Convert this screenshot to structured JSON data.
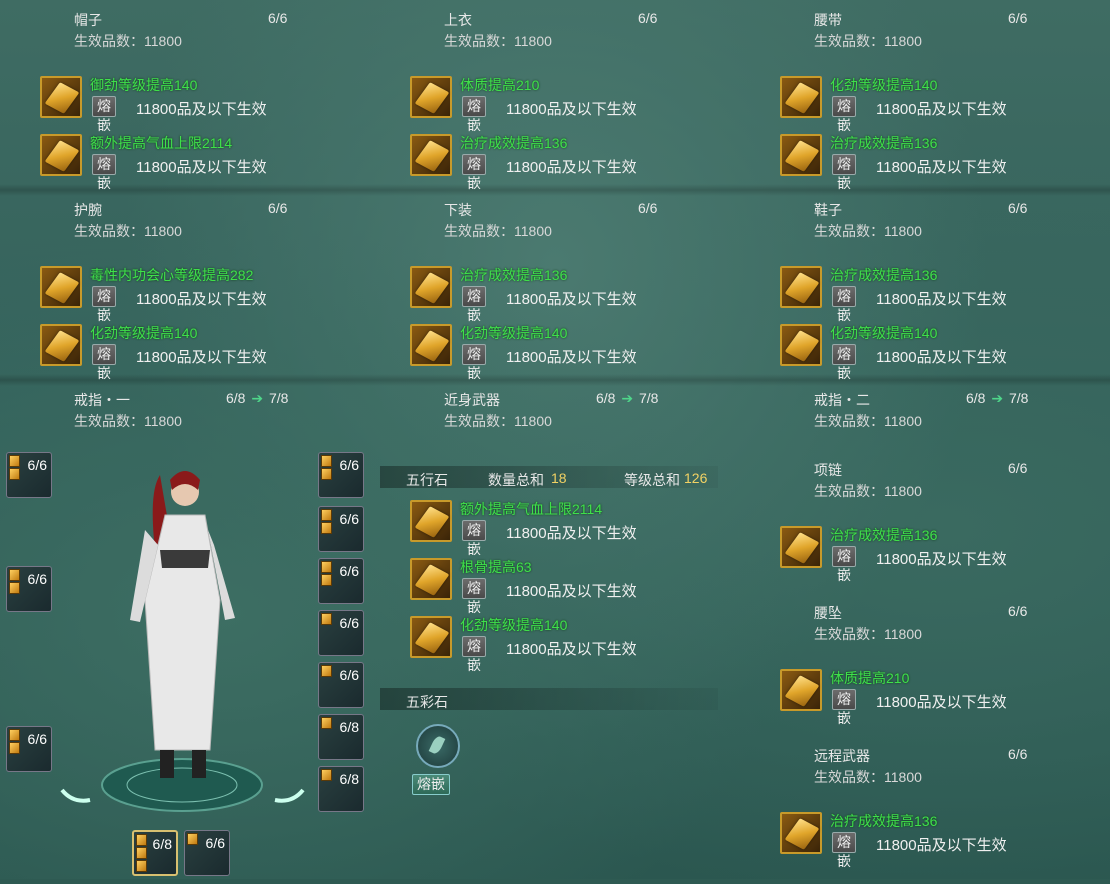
{
  "fuse_label": "熔嵌",
  "fuse_desc": "11800品及以下生效",
  "effect_label": "生效品数：11800",
  "equipment": [
    {
      "name": "帽子",
      "count": "6/6",
      "gems": [
        "御劲等级提高140",
        "额外提高气血上限2114"
      ]
    },
    {
      "name": "上衣",
      "count": "6/6",
      "gems": [
        "体质提高210",
        "治疗成效提高136"
      ]
    },
    {
      "name": "腰带",
      "count": "6/6",
      "gems": [
        "化劲等级提高140",
        "治疗成效提高136"
      ]
    },
    {
      "name": "护腕",
      "count": "6/6",
      "gems": [
        "毒性内功会心等级提高282",
        "化劲等级提高140"
      ]
    },
    {
      "name": "下装",
      "count": "6/6",
      "gems": [
        "治疗成效提高136",
        "化劲等级提高140"
      ]
    },
    {
      "name": "鞋子",
      "count": "6/6",
      "gems": [
        "治疗成效提高136",
        "化劲等级提高140"
      ]
    }
  ],
  "upgrades": [
    {
      "name": "戒指・一",
      "count": "6/8",
      "next": "7/8"
    },
    {
      "name": "近身武器",
      "count": "6/8",
      "next": "7/8"
    },
    {
      "name": "戒指・二",
      "count": "6/8",
      "next": "7/8"
    }
  ],
  "right_items": [
    {
      "name": "项链",
      "count": "6/6",
      "gem": "治疗成效提高136"
    },
    {
      "name": "腰坠",
      "count": "6/6",
      "gem": "体质提高210"
    },
    {
      "name": "远程武器",
      "count": "6/6",
      "gem": "治疗成效提高136"
    }
  ],
  "wuxing": {
    "title": "五行石",
    "qty_label": "数量总和",
    "qty": "18",
    "lvl_label": "等级总和",
    "lvl": "126",
    "gems": [
      "额外提高气血上限2114",
      "根骨提高63",
      "化劲等级提高140"
    ]
  },
  "wucai": {
    "title": "五彩石",
    "button": "熔嵌"
  },
  "slots_left": [
    "6/6",
    "6/6",
    "6/6"
  ],
  "slots_right": [
    "6/6",
    "6/6",
    "6/6",
    "6/6",
    "6/6",
    "6/8",
    "6/8"
  ],
  "slots_bottom": [
    "6/8",
    "6/6"
  ]
}
